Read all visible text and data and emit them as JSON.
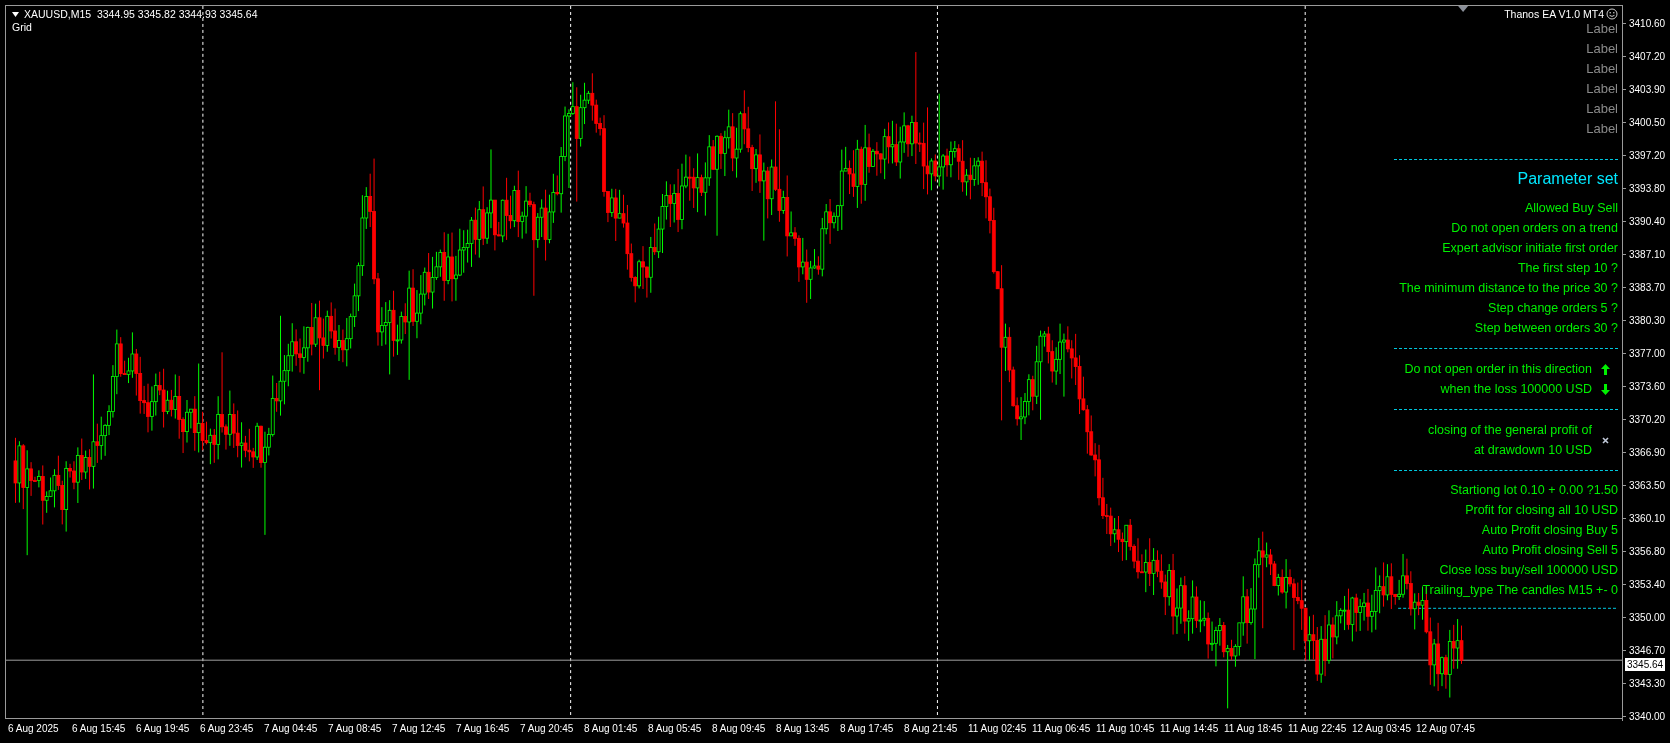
{
  "header": {
    "symbol_line": "XAUUSD,M15  3344.95 3345.82 3344.93 3345.64",
    "indicator": "Grid"
  },
  "ea_title": "Thanos EA V1.0 MT4",
  "labels": [
    "Label",
    "Label",
    "Label",
    "Label",
    "Label",
    "Label"
  ],
  "panel": {
    "title": "Parameter set",
    "settings": [
      "Allowed Buy Sell",
      "Do not open orders on a trend",
      "Expert advisor initiate first order",
      "The first step 10 ?",
      "The minimum distance to the price 30 ?",
      "Step change orders 5 ?",
      "Step between orders 30 ?"
    ],
    "direction_lines": [
      "Do not open order in this direction",
      "when the loss 100000 USD"
    ],
    "closing_lines": [
      "closing of the general profit of",
      "at drawdown 10 USD"
    ],
    "summary": [
      "Startiong lot 0.10 + 0.00 ?1.50",
      "Profit for closing all 10 USD",
      "Auto Profit closing Buy 5",
      "Auto Profit closing Sell 5",
      "Close loss buy/sell 100000 USD",
      "Trailing_type The candles M15 +- 0"
    ]
  },
  "price_axis": [
    "3410.60",
    "3407.20",
    "3403.90",
    "3400.50",
    "3397.20",
    "3393.80",
    "3390.40",
    "3387.10",
    "3383.70",
    "3380.30",
    "3377.00",
    "3373.60",
    "3370.20",
    "3366.90",
    "3363.50",
    "3360.10",
    "3356.80",
    "3353.40",
    "3350.00",
    "3346.70",
    "3343.30",
    "3340.00"
  ],
  "current_price": "3345.64",
  "time_axis": [
    "6 Aug 2025",
    "6 Aug 15:45",
    "6 Aug 19:45",
    "6 Aug 23:45",
    "7 Aug 04:45",
    "7 Aug 08:45",
    "7 Aug 12:45",
    "7 Aug 16:45",
    "7 Aug 20:45",
    "8 Aug 01:45",
    "8 Aug 05:45",
    "8 Aug 09:45",
    "8 Aug 13:45",
    "8 Aug 17:45",
    "8 Aug 21:45",
    "11 Aug 02:45",
    "11 Aug 06:45",
    "11 Aug 10:45",
    "11 Aug 14:45",
    "11 Aug 18:45",
    "11 Aug 22:45",
    "12 Aug 03:45",
    "12 Aug 07:45"
  ]
}
